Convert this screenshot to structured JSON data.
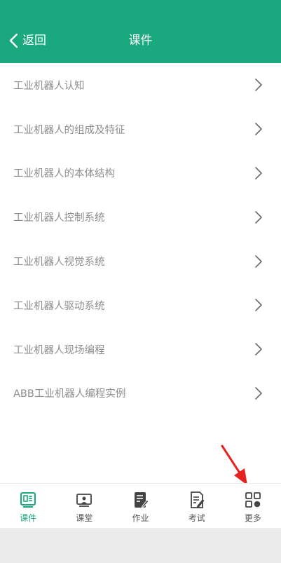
{
  "header": {
    "back_label": "返回",
    "title": "课件",
    "background": "#1aa97e"
  },
  "list": {
    "items": [
      {
        "label": "工业机器人认知"
      },
      {
        "label": "工业机器人的组成及特征"
      },
      {
        "label": "工业机器人的本体结构"
      },
      {
        "label": "工业机器人控制系统"
      },
      {
        "label": "工业机器人视觉系统"
      },
      {
        "label": "工业机器人驱动系统"
      },
      {
        "label": "工业机器人现场编程"
      },
      {
        "label": "ABB工业机器人编程实例"
      }
    ],
    "chevron_icon": "chevron-right-icon"
  },
  "tabbar": {
    "tabs": [
      {
        "label": "课件",
        "icon": "courseware-icon",
        "active": true
      },
      {
        "label": "课堂",
        "icon": "classroom-icon",
        "active": false
      },
      {
        "label": "作业",
        "icon": "homework-icon",
        "active": false
      },
      {
        "label": "考试",
        "icon": "exam-icon",
        "active": false
      },
      {
        "label": "更多",
        "icon": "more-grid-icon",
        "active": false
      }
    ],
    "active_color": "#1aa97e"
  },
  "annotation": {
    "icon": "red-arrow-icon",
    "color": "#e8231f"
  }
}
